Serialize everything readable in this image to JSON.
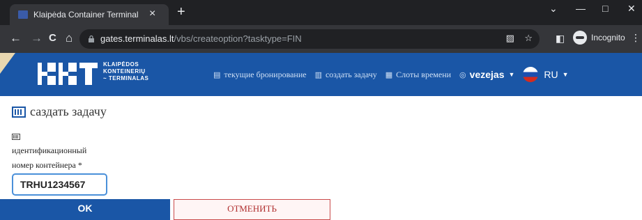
{
  "browser": {
    "tab_title": "Klaipėda Container Terminal",
    "tab_close": "×",
    "new_tab": "+",
    "url_host": "gates.terminalas.lt",
    "url_path": "/vbs/createoption?tasktype=FIN",
    "incognito_label": "Incognito",
    "nav_back": "←",
    "nav_forward": "→",
    "nav_reload": "C",
    "nav_home": "⌂",
    "win_min": "—",
    "win_max": "□",
    "win_close": "✕",
    "win_chevron": "⌄",
    "star": "☆",
    "menu": "⋮"
  },
  "header": {
    "logo_text": "KLAIPĖDOS\nKONTEINERIŲ\nTERMINALAS",
    "nav_items": [
      {
        "icon": "▤",
        "label": "текущие бронирование"
      },
      {
        "icon": "▥",
        "label": "создать задачу"
      },
      {
        "icon": "▦",
        "label": "Слоты времени"
      }
    ],
    "user_icon": "◎",
    "user": "vezejas",
    "lang": "RU",
    "colors": {
      "brand": "#1a56a6"
    }
  },
  "form": {
    "page_title": "саздать задачу",
    "field_label_line1": "идентификационный",
    "field_label_line2": "номер контейнера *",
    "container_value": "TRHU1234567",
    "ok_label": "OK",
    "cancel_label": "ОТМЕНИТЬ"
  }
}
